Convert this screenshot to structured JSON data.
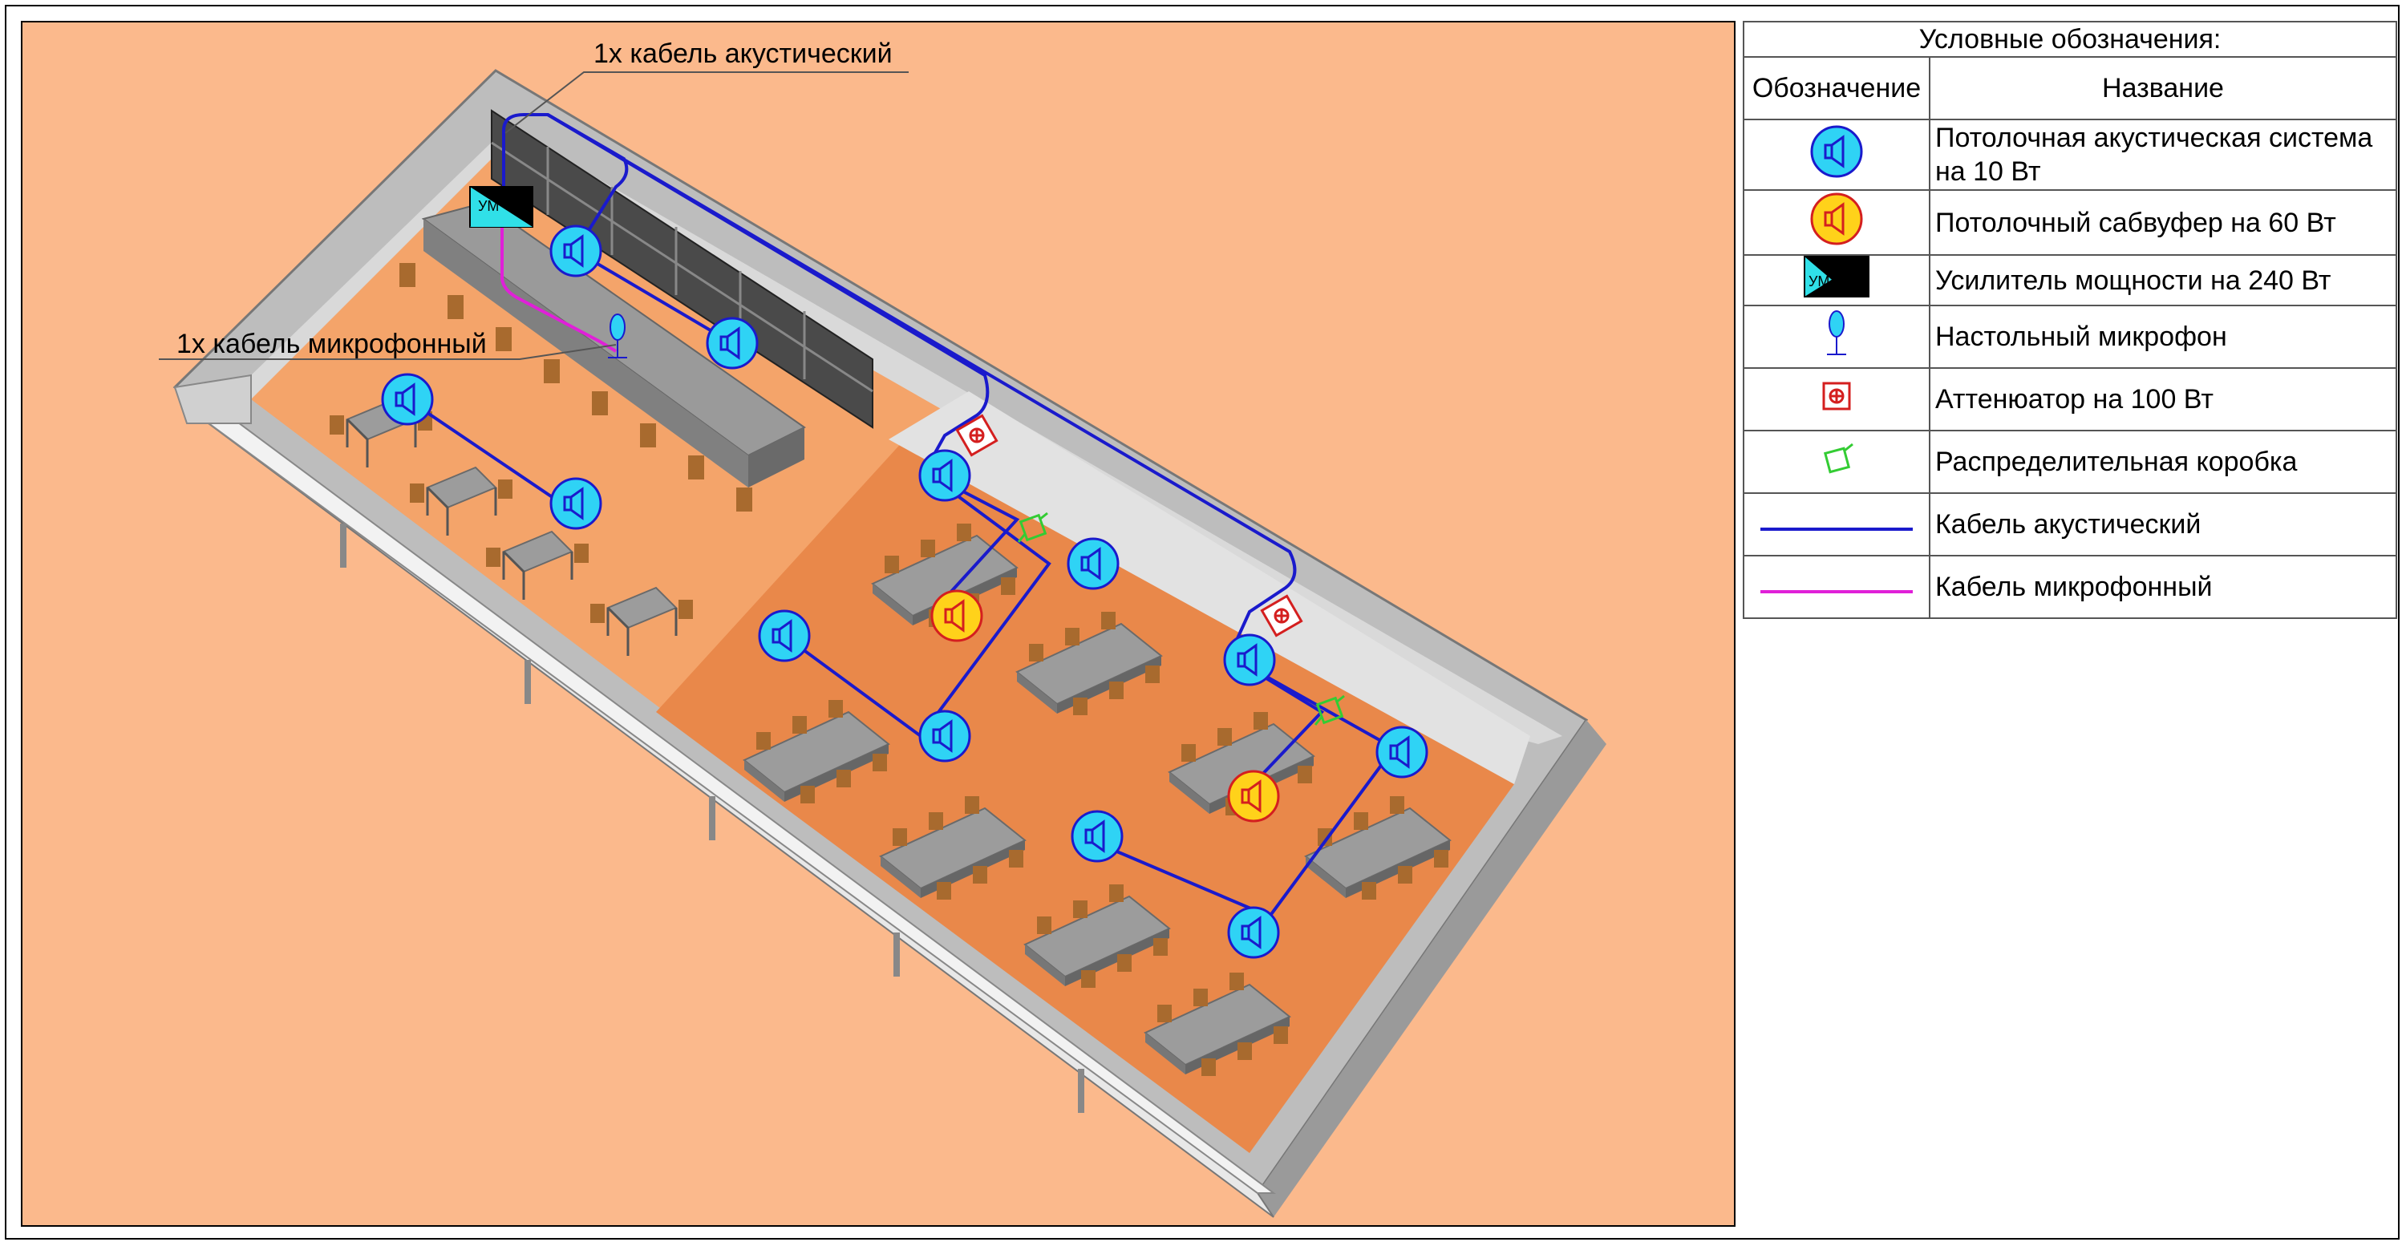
{
  "annotations": {
    "acoustic_cable_note": "1х кабель акустический",
    "mic_cable_note": "1х кабель микрофонный"
  },
  "amp_label": "УМ",
  "legend": {
    "caption": "Условные обозначения:",
    "col_symbol": "Обозначение",
    "col_name": "Название",
    "items": [
      {
        "icon": "ceiling-speaker-icon",
        "name": "Потолочная акустическая система на 10 Вт"
      },
      {
        "icon": "ceiling-subwoofer-icon",
        "name": "Потолочный сабвуфер на 60 Вт"
      },
      {
        "icon": "power-amplifier-icon",
        "name": "Усилитель мощности на 240 Вт"
      },
      {
        "icon": "desk-microphone-icon",
        "name": "Настольный микрофон"
      },
      {
        "icon": "attenuator-icon",
        "name": "Аттенюатор на 100 Вт"
      },
      {
        "icon": "junction-box-icon",
        "name": "Распределительная коробка"
      },
      {
        "icon": "acoustic-cable-line-icon",
        "name": "Кабель акустический"
      },
      {
        "icon": "microphone-cable-line-icon",
        "name": "Кабель микрофонный"
      }
    ]
  },
  "colors": {
    "background": "#fbb98c",
    "floor_light": "#f4a46a",
    "floor_dark": "#e9884a",
    "wall": "#d9d9d9",
    "speaker_fill": "#2fd3f5",
    "subwoofer_fill": "#ffd21a",
    "acoustic_cable": "#1a1acc",
    "microphone_cable": "#e020d8",
    "attenuator": "#d41f1f",
    "junction_box": "#33cc33",
    "amp_dark": "#000000",
    "amp_light": "#30e0e8"
  }
}
